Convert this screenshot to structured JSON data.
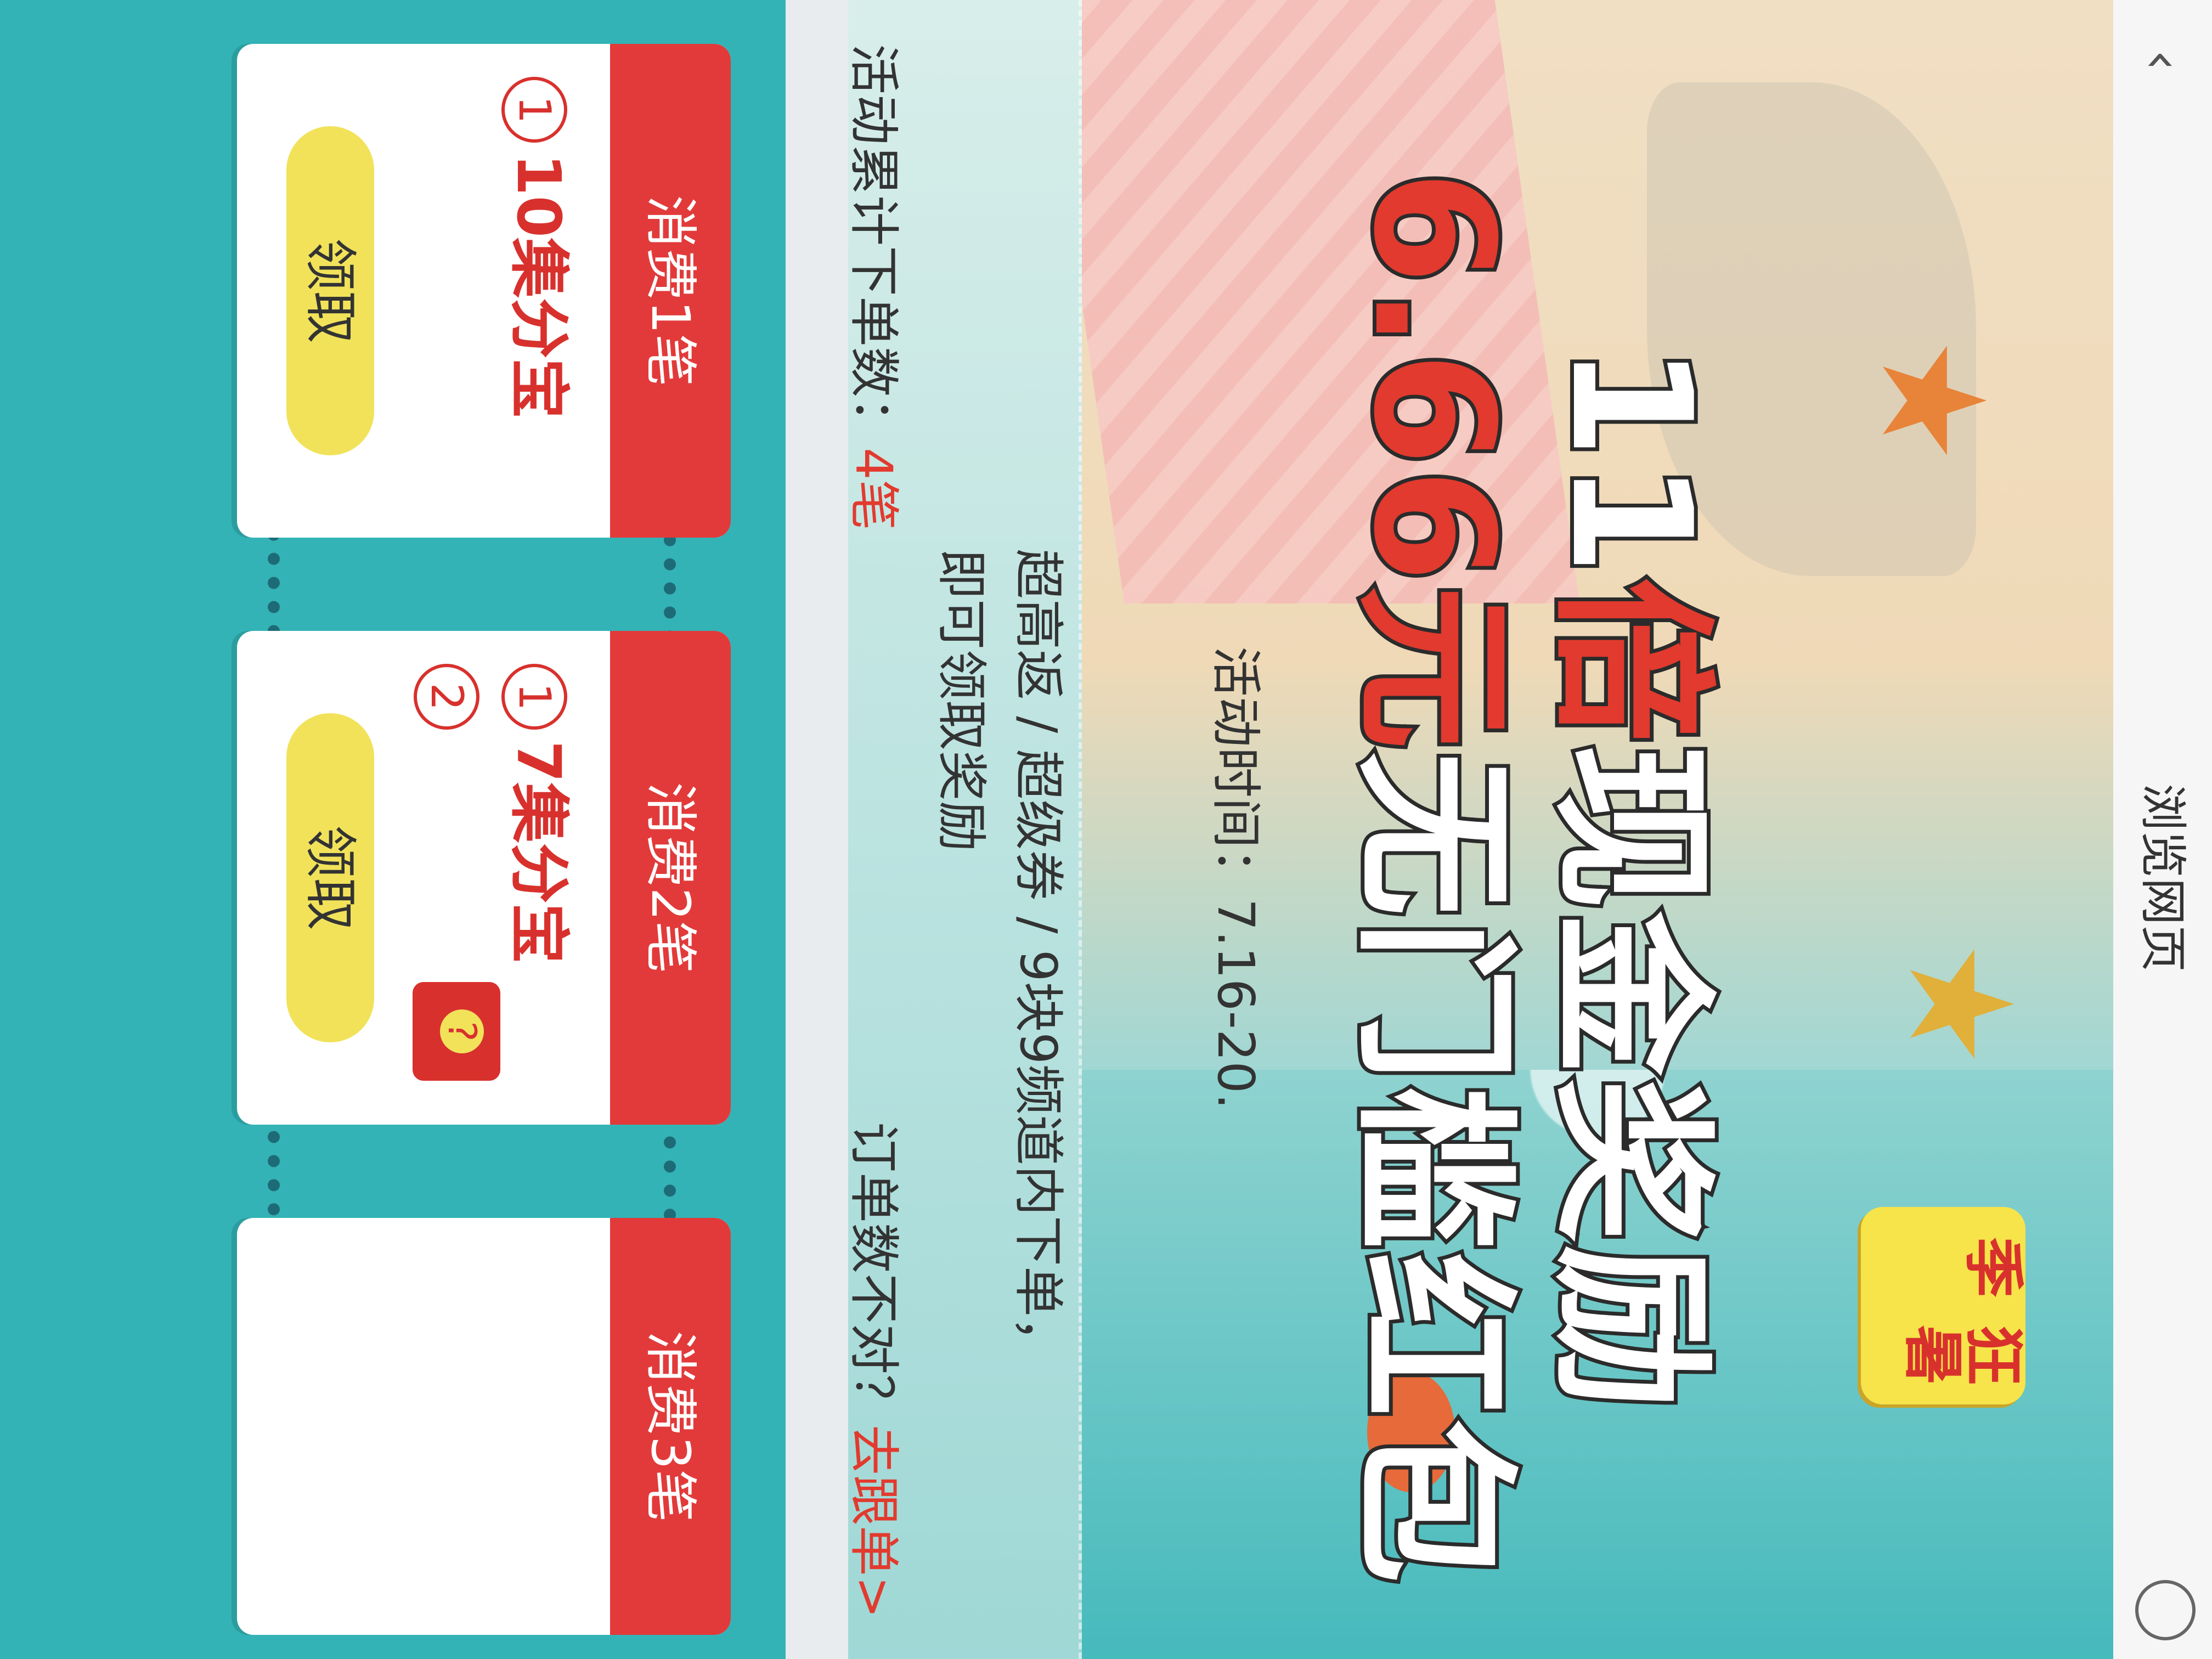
{
  "browser": {
    "page_title": "浏览网页"
  },
  "banner": {
    "badge": "狂暑季",
    "headline_line1_prefix": "11",
    "headline_line1_highlight": "倍",
    "headline_line1_suffix": "现金奖励",
    "headline_line2_highlight": "6.66",
    "headline_line2_mid": "元",
    "headline_line2_suffix": "无门槛红包",
    "activity_time": "活动时间：7.16-20."
  },
  "info": {
    "line1_a": "超高返 / 超级券 / 9块9频道内下单，",
    "line1_b": "即可领取奖励"
  },
  "order_count": {
    "label": "活动累计下单数：",
    "value": "4笔",
    "wrong_label": "订单数不对？",
    "track_link": "去跟单>"
  },
  "rewards": [
    {
      "head": "消费1笔",
      "num": "1",
      "item": "10集分宝",
      "button": "领取"
    },
    {
      "head": "消费2笔",
      "num": "1",
      "item": "7集分宝",
      "num2": "2",
      "button": "领取"
    },
    {
      "head": "消费3笔"
    }
  ],
  "colors": {
    "accent_red": "#e23a3a",
    "button_yellow": "#f1e25a",
    "sea": "#33b3b6"
  }
}
